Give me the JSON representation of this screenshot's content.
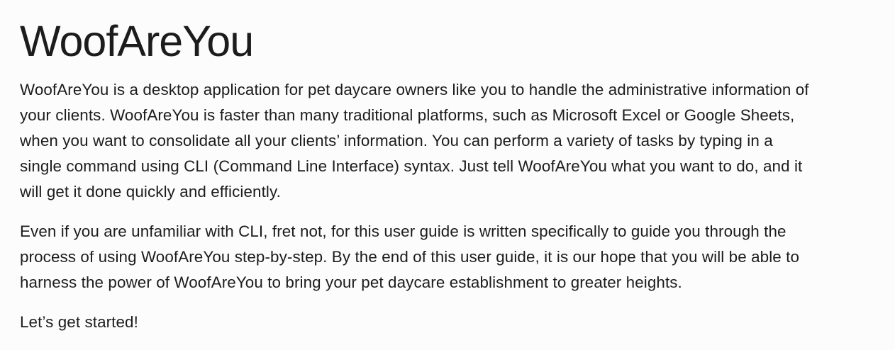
{
  "document": {
    "title": "WoofAreYou",
    "paragraphs": [
      "WoofAreYou is a desktop application for pet daycare owners like you to handle the administrative information of your clients. WoofAreYou is faster than many traditional platforms, such as Microsoft Excel or Google Sheets, when you want to consolidate all your clients’ information. You can perform a variety of tasks by typing in a single command using CLI (Command Line Interface) syntax. Just tell WoofAreYou what you want to do, and it will get it done quickly and efficiently.",
      "Even if you are unfamiliar with CLI, fret not, for this user guide is written specifically to guide you through the process of using WoofAreYou step-by-step. By the end of this user guide, it is our hope that you will be able to harness the power of WoofAreYou to bring your pet daycare establishment to greater heights.",
      "Let’s get started!"
    ]
  }
}
